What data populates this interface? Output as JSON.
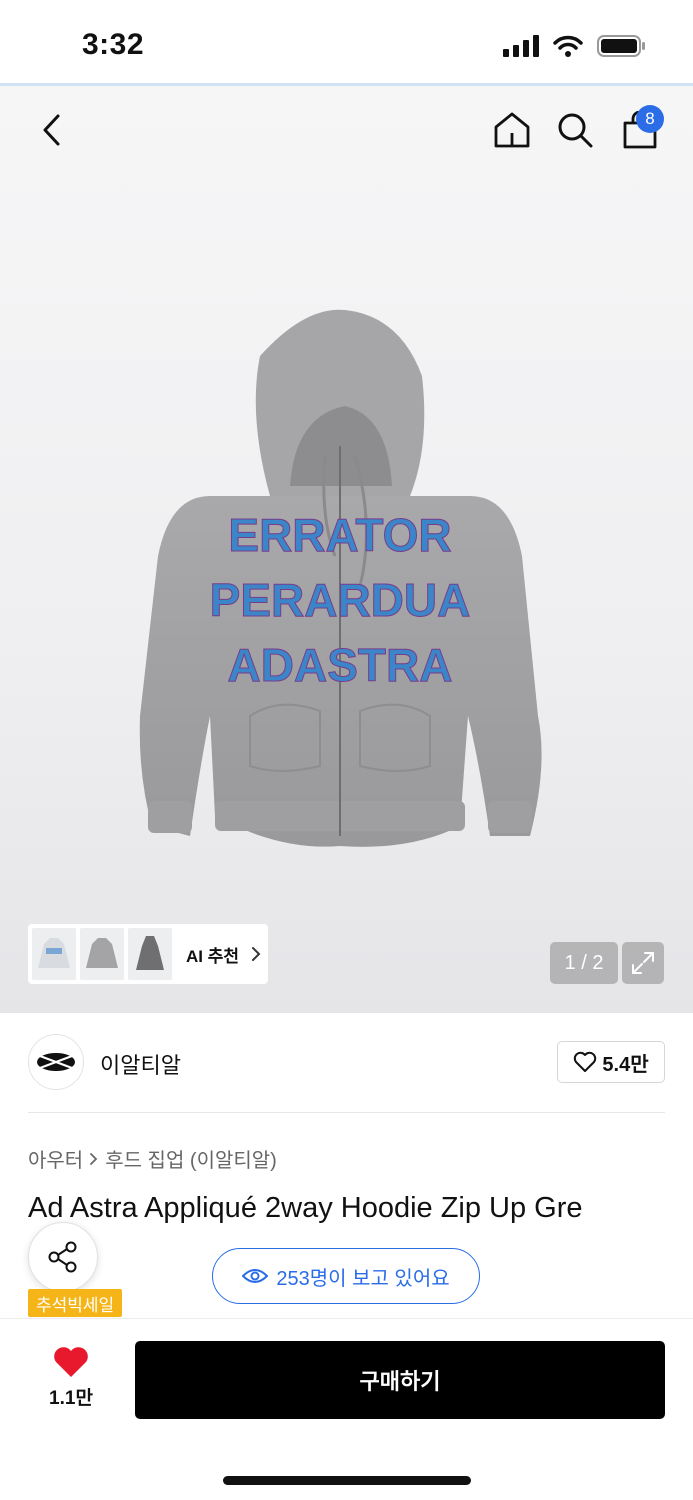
{
  "status_bar": {
    "time": "3:32"
  },
  "header": {
    "cart_count": "8"
  },
  "gallery": {
    "ai_label": "AI 추천",
    "pager": "1 / 2"
  },
  "hoodie_print": {
    "line1": "ERRATOR",
    "line2": "PERARDUA",
    "line3": "ADASTRA"
  },
  "brand": {
    "name": "이알티알",
    "likes": "5.4만"
  },
  "breadcrumb": {
    "level1": "아우터",
    "level2": "후드 집업 (이알티알)"
  },
  "product": {
    "title": "Ad Astra Appliqué 2way Hoodie Zip Up Gre"
  },
  "viewers": {
    "text": "253명이 보고 있어요"
  },
  "badge": {
    "sale": "추석빅세일"
  },
  "bottom": {
    "wish_count": "1.1만",
    "buy_label": "구매하기"
  },
  "colors": {
    "accent": "#2b6de7",
    "wish_heart": "#e8192c",
    "sale_badge": "#f5b417",
    "buy_button": "#000000"
  }
}
